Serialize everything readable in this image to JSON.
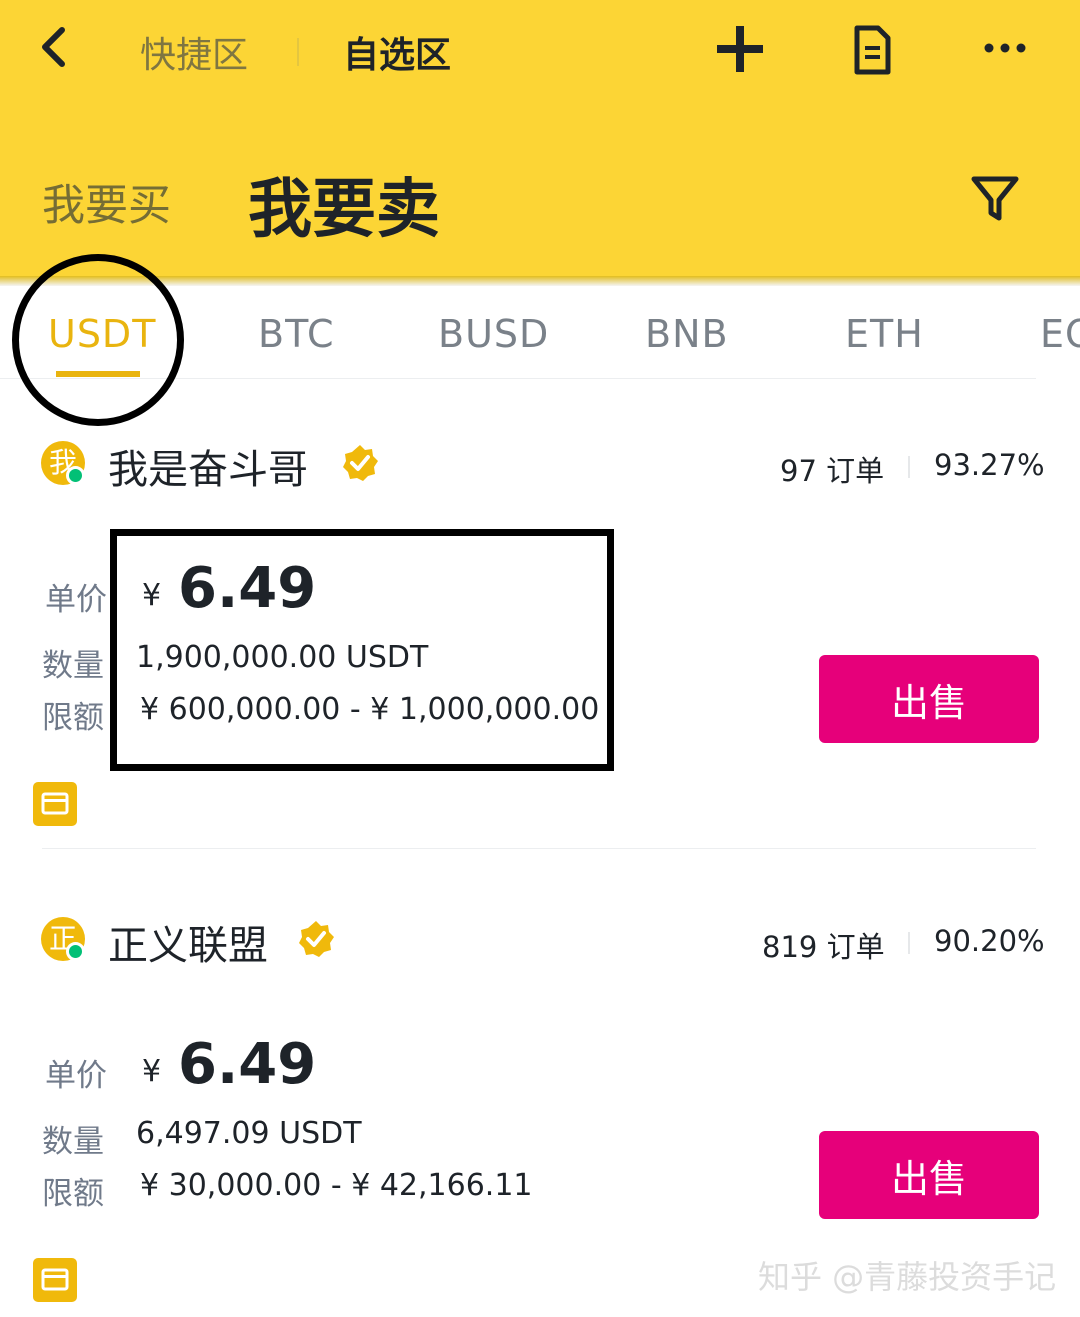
{
  "header": {
    "zone_quick": "快捷区",
    "zone_fav": "自选区",
    "tab_buy": "我要买",
    "tab_sell": "我要卖",
    "bg_color": "#fcd535"
  },
  "coin_tabs": [
    "USDT",
    "BTC",
    "BUSD",
    "BNB",
    "ETH",
    "EO"
  ],
  "active_coin": "USDT",
  "ads": [
    {
      "avatar": "我",
      "merchant": "我是奋斗哥",
      "orders": "97 订单",
      "completion": "93.27%",
      "price_label": "单价",
      "currency": "¥",
      "price": "6.49",
      "qty_label": "数量",
      "qty": "1,900,000.00 USDT",
      "limit_label": "限额",
      "limit": "¥ 600,000.00 - ¥ 1,000,000.00",
      "action": "出售"
    },
    {
      "avatar": "正",
      "merchant": "正义联盟",
      "orders": "819 订单",
      "completion": "90.20%",
      "price_label": "单价",
      "currency": "¥",
      "price": "6.49",
      "qty_label": "数量",
      "qty": "6,497.09 USDT",
      "limit_label": "限额",
      "limit": "¥ 30,000.00 - ¥ 42,166.11",
      "action": "出售"
    }
  ],
  "watermark": "知乎 @青藤投资手记",
  "icons": [
    "back-arrow-icon",
    "plus-icon",
    "document-icon",
    "more-icon",
    "filter-icon",
    "verified-badge-icon",
    "wallet-icon"
  ],
  "colors": {
    "accent": "#e9b40f",
    "sell_button": "#e6007a"
  }
}
